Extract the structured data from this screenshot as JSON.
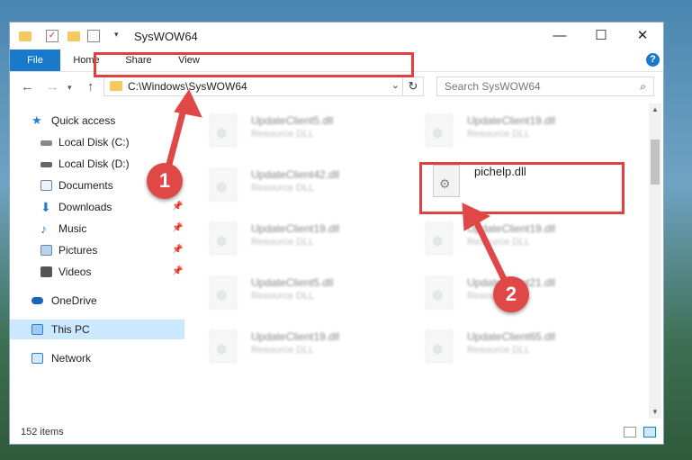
{
  "window": {
    "title": "SysWOW64",
    "controls": {
      "minimize": "—",
      "maximize": "☐",
      "close": "✕"
    }
  },
  "ribbon": {
    "tabs": [
      "File",
      "Home",
      "Share",
      "View"
    ],
    "help": "?"
  },
  "navigation": {
    "back": "←",
    "forward": "→",
    "up": "↑",
    "address": "C:\\Windows\\SysWOW64",
    "refresh": "↻",
    "search_placeholder": "Search SysWOW64"
  },
  "sidebar": {
    "items": [
      {
        "label": "Quick access",
        "icon": "star-icon",
        "pinned": false
      },
      {
        "label": "Local Disk (C:)",
        "icon": "drive-icon",
        "pinned": false
      },
      {
        "label": "Local Disk (D:)",
        "icon": "drive-icon",
        "pinned": false
      },
      {
        "label": "Documents",
        "icon": "documents-icon",
        "pinned": true
      },
      {
        "label": "Downloads",
        "icon": "downloads-icon",
        "pinned": true
      },
      {
        "label": "Music",
        "icon": "music-icon",
        "pinned": true
      },
      {
        "label": "Pictures",
        "icon": "pictures-icon",
        "pinned": true
      },
      {
        "label": "Videos",
        "icon": "videos-icon",
        "pinned": true
      },
      {
        "label": "OneDrive",
        "icon": "cloud-icon",
        "pinned": false
      },
      {
        "label": "This PC",
        "icon": "computer-icon",
        "pinned": false,
        "selected": true
      },
      {
        "label": "Network",
        "icon": "network-icon",
        "pinned": false
      }
    ]
  },
  "files": [
    {
      "name": "UpdateClient5.dll",
      "type": "Resource DLL"
    },
    {
      "name": "UpdateClient19.dll",
      "type": "Resource DLL"
    },
    {
      "name": "UpdateClient42.dll",
      "type": "Resource DLL"
    },
    {
      "name": "pichelp.dll",
      "type": "",
      "highlighted": true
    },
    {
      "name": "UpdateClient19.dll",
      "type": "Resource DLL"
    },
    {
      "name": "UpdateClient19.dll",
      "type": "Resource DLL"
    },
    {
      "name": "UpdateClient5.dll",
      "type": "Resource DLL"
    },
    {
      "name": "UpdateClient21.dll",
      "type": "Resource DLL"
    },
    {
      "name": "UpdateClient19.dll",
      "type": "Resource DLL"
    },
    {
      "name": "UpdateClient65.dll",
      "type": "Resource DLL"
    }
  ],
  "status": {
    "item_count": "152 items"
  },
  "annotations": {
    "step1": "1",
    "step2": "2",
    "color": "#e04848"
  }
}
